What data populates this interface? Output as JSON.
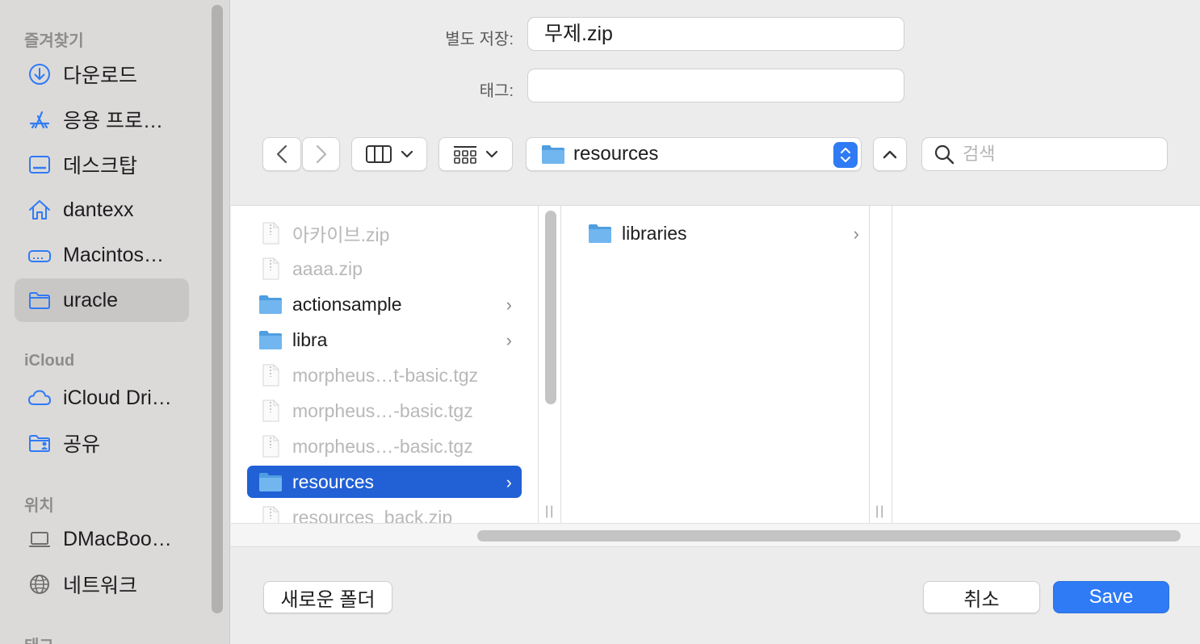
{
  "sidebar": {
    "favorites_header": "즐겨찾기",
    "icloud_header": "iCloud",
    "locations_header": "위치",
    "tags_header": "태그",
    "favorites": [
      {
        "label": "다운로드",
        "icon": "download-icon"
      },
      {
        "label": "응용 프로…",
        "icon": "applications-icon"
      },
      {
        "label": "데스크탑",
        "icon": "desktop-icon"
      },
      {
        "label": "dantexx",
        "icon": "home-icon"
      },
      {
        "label": "Macintos…",
        "icon": "drive-icon"
      },
      {
        "label": "uracle",
        "icon": "folder-icon",
        "selected": true
      }
    ],
    "icloud": [
      {
        "label": "iCloud Dri…",
        "icon": "cloud-icon"
      },
      {
        "label": "공유",
        "icon": "shared-folder-icon"
      }
    ],
    "locations": [
      {
        "label": "DMacBoo…",
        "icon": "laptop-icon"
      },
      {
        "label": "네트워크",
        "icon": "network-icon"
      }
    ]
  },
  "form": {
    "save_as_label": "별도 저장:",
    "save_as_value": "무제.zip",
    "tags_label": "태그:",
    "tags_value": ""
  },
  "toolbar": {
    "location": "resources",
    "search_placeholder": "검색"
  },
  "browser": {
    "column1": [
      {
        "name": "아카이브.zip",
        "type": "file",
        "dim": true
      },
      {
        "name": "aaaa.zip",
        "type": "file",
        "dim": true
      },
      {
        "name": "actionsample",
        "type": "folder"
      },
      {
        "name": "libra",
        "type": "folder"
      },
      {
        "name": "morpheus…t-basic.tgz",
        "type": "file",
        "dim": true
      },
      {
        "name": "morpheus…-basic.tgz",
        "type": "file",
        "dim": true
      },
      {
        "name": "morpheus…-basic.tgz",
        "type": "file",
        "dim": true
      },
      {
        "name": "resources",
        "type": "folder",
        "selected": true
      },
      {
        "name": "resources_back.zip",
        "type": "file",
        "dim": true
      }
    ],
    "column2": [
      {
        "name": "libraries",
        "type": "folder"
      }
    ]
  },
  "buttons": {
    "new_folder": "새로운 폴더",
    "cancel": "취소",
    "save": "Save"
  },
  "colors": {
    "accent": "#2f7bf5",
    "selection": "#2160d5",
    "folder": "#5aa8e6"
  }
}
